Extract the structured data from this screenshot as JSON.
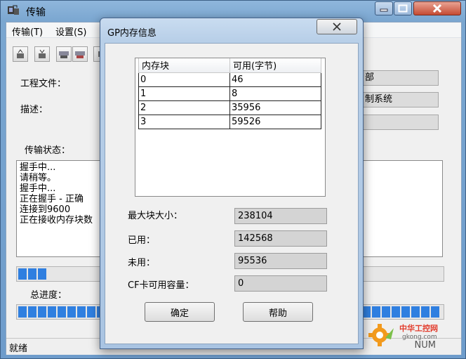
{
  "main_window": {
    "title": "传输",
    "menu": [
      "传输(T)",
      "设置(S)"
    ],
    "toolbar_icons": [
      "upload-icon",
      "download-icon",
      "sys-upload-icon",
      "sys-download-icon",
      "more-icon"
    ],
    "labels": {
      "project_file": "工程文件：",
      "description": "描述：",
      "transfer_status": "传输状态：",
      "total_progress": "总进度："
    },
    "fields": {
      "project_file_tail": "部",
      "description_tail": "制系统"
    },
    "status_log": [
      "握手中...",
      "请稍等。",
      "握手中...",
      "正在握手 - 正确",
      "连接到9600",
      "正在接收内存块数"
    ],
    "transfer_progress_fraction": 0.06,
    "total_progress_fraction": 1.0,
    "status_bar": "就绪",
    "num_indicator": "NUM",
    "watermark": {
      "text": "中华工控网",
      "sub": "gkong.com"
    }
  },
  "dialog": {
    "title": "GP内存信息",
    "table": {
      "headers": [
        "内存块",
        "可用(字节)"
      ],
      "rows": [
        [
          "0",
          "46"
        ],
        [
          "1",
          "8"
        ],
        [
          "2",
          "35956"
        ],
        [
          "3",
          "59526"
        ]
      ]
    },
    "stats": [
      {
        "label": "最大块大小：",
        "value": "238104"
      },
      {
        "label": "已用：",
        "value": "142568"
      },
      {
        "label": "未用：",
        "value": "95536"
      },
      {
        "label": "CF卡可用容量：",
        "value": "0"
      }
    ],
    "ok_label": "确定",
    "help_label": "帮助"
  },
  "colors": {
    "progress_fill": "#2f7fe0",
    "titlebar": "#7aa6d0"
  }
}
